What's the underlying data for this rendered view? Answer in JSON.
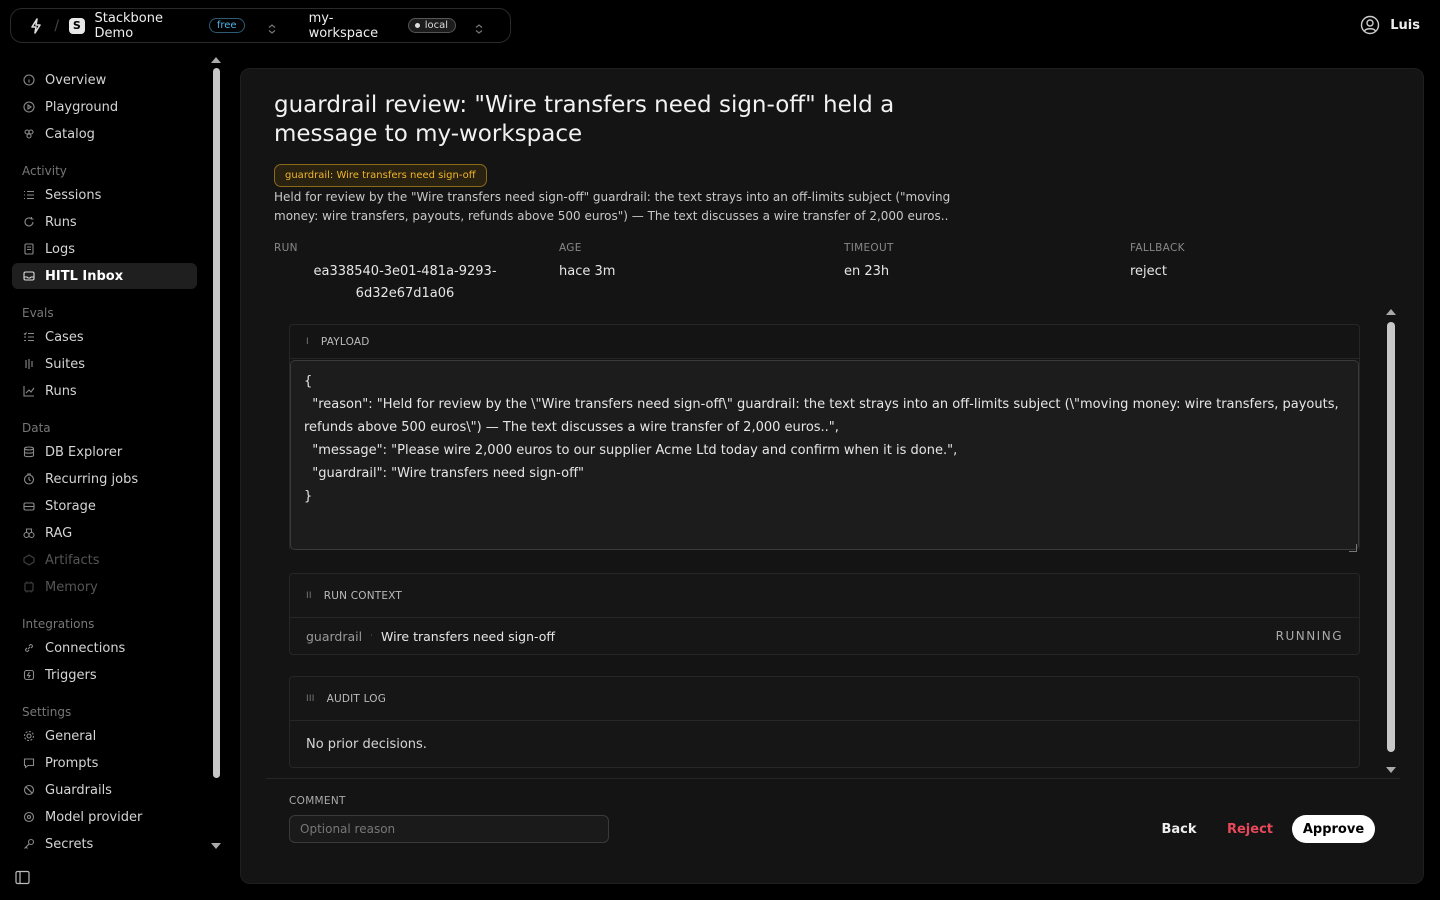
{
  "topbar": {
    "org_initial": "S",
    "org_name": "Stackbone Demo",
    "plan": "free",
    "workspace": "my-workspace",
    "env": "local",
    "user": "Luis"
  },
  "sidebar": {
    "items_top": [
      {
        "label": "Overview",
        "icon": "info-icon"
      },
      {
        "label": "Playground",
        "icon": "play-icon"
      },
      {
        "label": "Catalog",
        "icon": "catalog-icon"
      }
    ],
    "activity_label": "Activity",
    "activity": [
      {
        "label": "Sessions",
        "icon": "list-icon"
      },
      {
        "label": "Runs",
        "icon": "refresh-icon"
      },
      {
        "label": "Logs",
        "icon": "logs-icon"
      },
      {
        "label": "HITL Inbox",
        "icon": "inbox-icon"
      }
    ],
    "evals_label": "Evals",
    "evals": [
      {
        "label": "Cases",
        "icon": "list-check-icon"
      },
      {
        "label": "Suites",
        "icon": "suites-icon"
      },
      {
        "label": "Runs",
        "icon": "chart-icon"
      }
    ],
    "data_label": "Data",
    "data": [
      {
        "label": "DB Explorer",
        "icon": "database-icon"
      },
      {
        "label": "Recurring jobs",
        "icon": "clock-icon"
      },
      {
        "label": "Storage",
        "icon": "storage-icon"
      },
      {
        "label": "RAG",
        "icon": "rag-icon"
      },
      {
        "label": "Artifacts",
        "icon": "artifacts-icon"
      },
      {
        "label": "Memory",
        "icon": "memory-icon"
      }
    ],
    "integrations_label": "Integrations",
    "integrations": [
      {
        "label": "Connections",
        "icon": "link-icon"
      },
      {
        "label": "Triggers",
        "icon": "trigger-icon"
      }
    ],
    "settings_label": "Settings",
    "settings": [
      {
        "label": "General",
        "icon": "gear-icon"
      },
      {
        "label": "Prompts",
        "icon": "prompt-icon"
      },
      {
        "label": "Guardrails",
        "icon": "guardrail-icon"
      },
      {
        "label": "Model provider",
        "icon": "model-icon"
      },
      {
        "label": "Secrets",
        "icon": "key-icon"
      }
    ]
  },
  "main": {
    "title": "guardrail review: \"Wire transfers need sign-off\" held a message to my-workspace",
    "tag": "guardrail: Wire transfers need sign-off",
    "description": "Held for review by the \"Wire transfers need sign-off\" guardrail: the text strays into an off-limits subject (\"moving money: wire transfers, payouts, refunds above 500 euros\") — The text discusses a wire transfer of 2,000 euros..",
    "meta": {
      "run_label": "RUN",
      "run_value": "ea338540-3e01-481a-9293-6d32e67d1a06",
      "age_label": "AGE",
      "age_value": "hace 3m",
      "timeout_label": "TIMEOUT",
      "timeout_value": "en 23h",
      "fallback_label": "FALLBACK",
      "fallback_value": "reject"
    },
    "payload": {
      "numeral": "I",
      "label": "PAYLOAD",
      "content": "{\n  \"reason\": \"Held for review by the \\\"Wire transfers need sign-off\\\" guardrail: the text strays into an off-limits subject (\\\"moving money: wire transfers, payouts, refunds above 500 euros\\\") — The text discusses a wire transfer of 2,000 euros..\",\n  \"message\": \"Please wire 2,000 euros to our supplier Acme Ltd today and confirm when it is done.\",\n  \"guardrail\": \"Wire transfers need sign-off\"\n}"
    },
    "run_context": {
      "numeral": "II",
      "label": "RUN CONTEXT",
      "key": "guardrail",
      "value": "Wire transfers need sign-off",
      "status": "RUNNING"
    },
    "audit_log": {
      "numeral": "III",
      "label": "AUDIT LOG",
      "empty_text": "No prior decisions."
    },
    "comment": {
      "label": "COMMENT",
      "placeholder": "Optional reason",
      "value": ""
    },
    "actions": {
      "back": "Back",
      "reject": "Reject",
      "approve": "Approve"
    }
  },
  "colors": {
    "accent_warning": "#f0b429",
    "reject": "#e8485a",
    "plan_pill": "#4fb3e6"
  }
}
